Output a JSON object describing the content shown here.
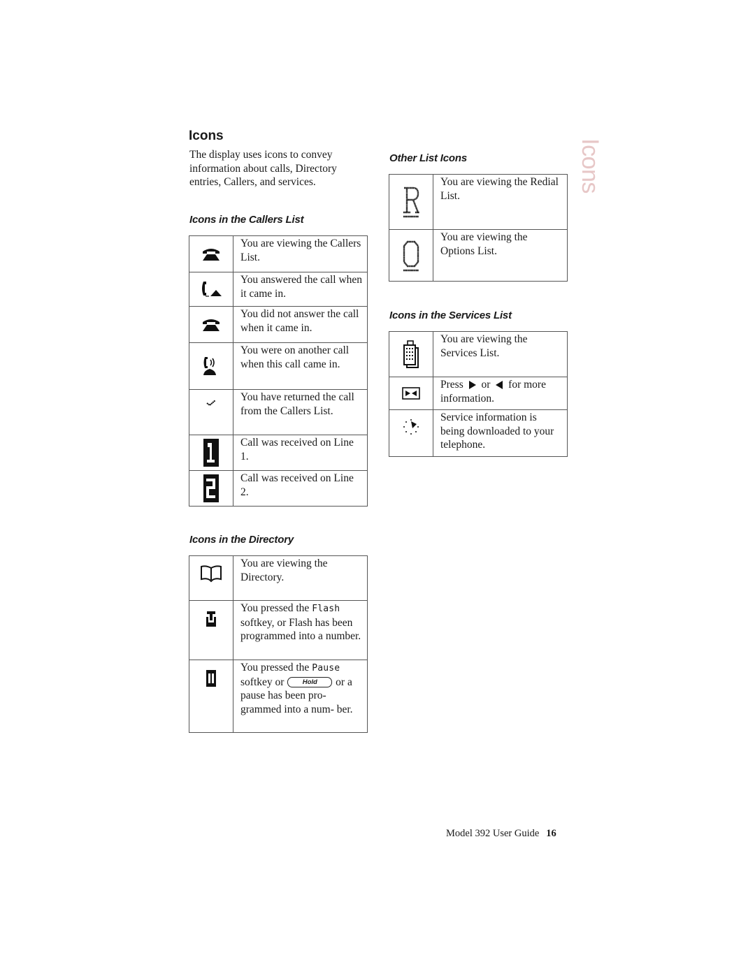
{
  "page": {
    "title": "Icons",
    "intro": "The display uses icons to convey information about calls, Directory entries, Callers, and services.",
    "side_tab": "Icons",
    "footer": {
      "guide": "Model 392 User Guide",
      "page_number": "16"
    }
  },
  "callers": {
    "heading": "Icons in the Callers List",
    "rows": [
      {
        "icon": "telephone-icon",
        "text": "You are viewing the Callers List."
      },
      {
        "icon": "answered-call-icon",
        "text": "You answered the call when it came in."
      },
      {
        "icon": "missed-call-icon",
        "text": "You did not answer the call when it came in."
      },
      {
        "icon": "call-waiting-icon",
        "text": "You were on another call when this call came in."
      },
      {
        "icon": "checkmark-icon",
        "text": "You have returned the call from the Callers List."
      },
      {
        "icon": "line-1-icon",
        "text": "Call was received on Line 1."
      },
      {
        "icon": "line-2-icon",
        "text": "Call was received on Line 2."
      }
    ]
  },
  "directory": {
    "heading": "Icons in the Directory",
    "rows": [
      {
        "icon": "book-icon",
        "text": "You are viewing the Directory."
      },
      {
        "icon": "flash-icon",
        "text_before": "You pressed the",
        "softkey": "Flash",
        "text_after": "softkey, or Flash has been programmed into a number."
      },
      {
        "icon": "pause-icon",
        "text_before": "You pressed the",
        "softkey": "Pause",
        "text_mid": "softkey or",
        "button": "Hold",
        "text_after": "or a pause has been pro- grammed into a num- ber."
      }
    ]
  },
  "other": {
    "heading": "Other List Icons",
    "rows": [
      {
        "icon": "redial-r-icon",
        "text": "You are viewing the Redial List."
      },
      {
        "icon": "options-o-icon",
        "text": "You are viewing the Options List."
      }
    ]
  },
  "services": {
    "heading": "Icons in the Services List",
    "rows": [
      {
        "icon": "services-building-icon",
        "text": "You are viewing the Services List."
      },
      {
        "icon": "scroll-arrows-icon",
        "text_before": "Press",
        "text_mid": "or",
        "text_after": "for more information."
      },
      {
        "icon": "download-progress-icon",
        "text": "Service information is being downloaded to your telephone."
      }
    ]
  }
}
